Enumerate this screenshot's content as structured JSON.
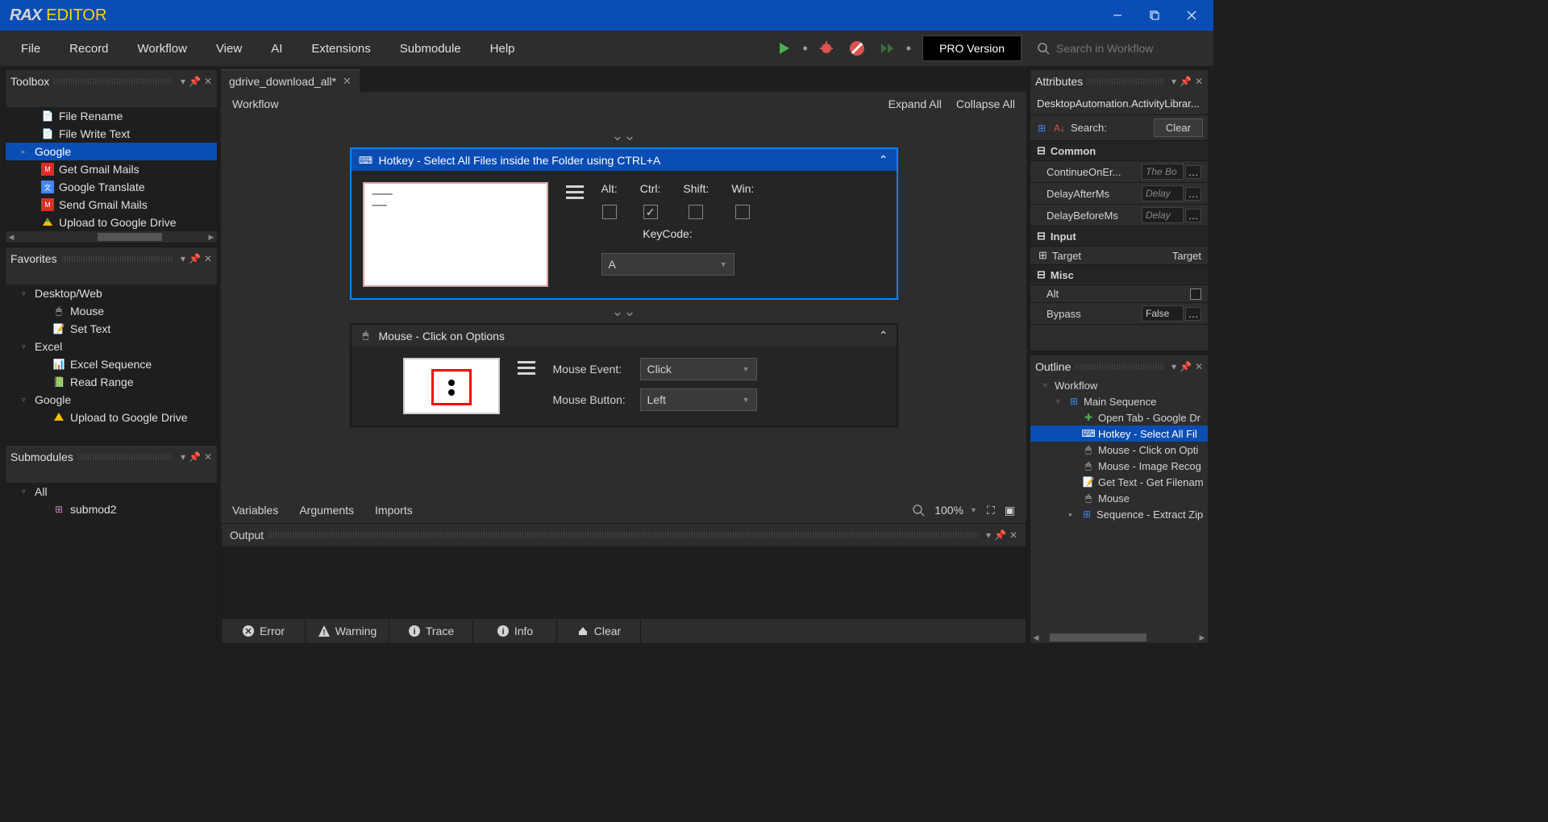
{
  "app": {
    "name_a": "RAX",
    "name_b": "EDITOR"
  },
  "menu": [
    "File",
    "Record",
    "Workflow",
    "View",
    "AI",
    "Extensions",
    "Submodule",
    "Help"
  ],
  "pro_label": "PRO Version",
  "search_placeholder": "Search in Workflow",
  "tab_name": "gdrive_download_all*",
  "wf": {
    "label": "Workflow",
    "expand": "Expand All",
    "collapse": "Collapse All"
  },
  "toolbox": {
    "title": "Toolbox",
    "items": [
      {
        "label": "File Rename",
        "indent": true,
        "icon": "file"
      },
      {
        "label": "File Write Text",
        "indent": true,
        "icon": "file"
      }
    ],
    "selected": "Google",
    "google_items": [
      {
        "label": "Get Gmail Mails",
        "icon": "gmail"
      },
      {
        "label": "Google Translate",
        "icon": "gtranslate"
      },
      {
        "label": "Send Gmail Mails",
        "icon": "gmail"
      },
      {
        "label": "Upload to Google Drive",
        "icon": "gdrive"
      }
    ]
  },
  "favorites": {
    "title": "Favorites",
    "groups": [
      {
        "name": "Desktop/Web",
        "items": [
          {
            "label": "Mouse",
            "icon": "mouse"
          },
          {
            "label": "Set Text",
            "icon": "text"
          }
        ]
      },
      {
        "name": "Excel",
        "items": [
          {
            "label": "Excel Sequence",
            "icon": "excel"
          },
          {
            "label": "Read Range",
            "icon": "range"
          }
        ]
      },
      {
        "name": "Google",
        "items": [
          {
            "label": "Upload to Google Drive",
            "icon": "gdrive"
          }
        ]
      }
    ]
  },
  "submodules": {
    "title": "Submodules",
    "root": "All",
    "items": [
      "submod2"
    ]
  },
  "activity1": {
    "title": "Hotkey - Select All Files inside the Folder using CTRL+A",
    "alt": "Alt:",
    "ctrl": "Ctrl:",
    "shift": "Shift:",
    "win": "Win:",
    "keycode_label": "KeyCode:",
    "keycode_value": "A"
  },
  "activity2": {
    "title": "Mouse - Click on Options",
    "event_label": "Mouse Event:",
    "event_value": "Click",
    "button_label": "Mouse Button:",
    "button_value": "Left"
  },
  "bottom_tabs": [
    "Variables",
    "Arguments",
    "Imports"
  ],
  "zoom": "100%",
  "output": {
    "title": "Output",
    "filters": [
      "Error",
      "Warning",
      "Trace",
      "Info",
      "Clear"
    ]
  },
  "attributes": {
    "title": "Attributes",
    "type": "DesktopAutomation.ActivityLibrar...",
    "search": "Search:",
    "clear": "Clear",
    "groups": {
      "common": {
        "label": "Common",
        "rows": [
          {
            "name": "ContinueOnEr...",
            "ph": "The Bo",
            "dots": true
          },
          {
            "name": "DelayAfterMs",
            "ph": "Delay",
            "dots": true
          },
          {
            "name": "DelayBeforeMs",
            "ph": "Delay",
            "dots": true
          }
        ]
      },
      "input": {
        "label": "Input",
        "target_name": "Target",
        "target_val": "Target"
      },
      "misc": {
        "label": "Misc",
        "alt": "Alt",
        "bypass_name": "Bypass",
        "bypass_val": "False"
      }
    }
  },
  "outline": {
    "title": "Outline",
    "root": "Workflow",
    "seq": "Main Sequence",
    "items": [
      "Open Tab - Google Dr",
      "Hotkey - Select All Fil",
      "Mouse - Click on Opti",
      "Mouse - Image Recog",
      "Get Text - Get Filenam",
      "Mouse"
    ],
    "last": "Sequence - Extract Zip"
  }
}
